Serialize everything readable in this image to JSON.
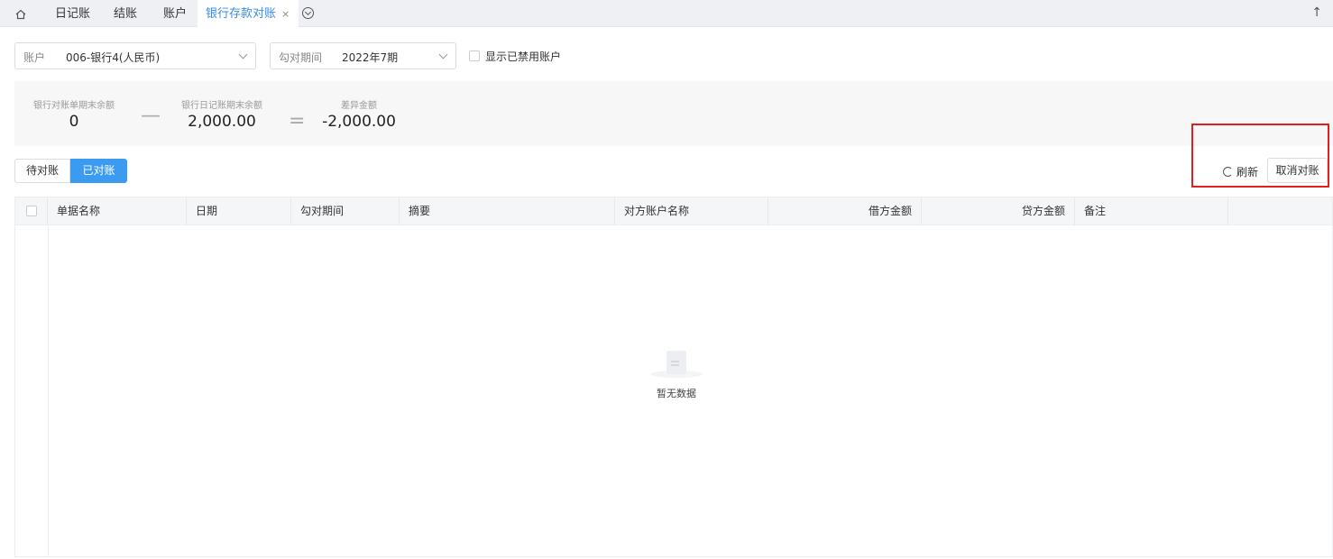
{
  "tabs": [
    {
      "label": "日记账"
    },
    {
      "label": "结账"
    },
    {
      "label": "账户"
    },
    {
      "label": "银行存款对账",
      "close": "×"
    }
  ],
  "filters": {
    "account_label": "账户",
    "account_value": "006-银行4(人民币)",
    "period_label": "勾对期间",
    "period_value": "2022年7期",
    "show_disabled_label": "显示已禁用账户"
  },
  "summary": {
    "bank_caption": "银行对账单期末余额",
    "bank_value": "0",
    "minus": "—",
    "journal_caption": "银行日记账期末余额",
    "journal_value": "2,000.00",
    "equals": "=",
    "diff_caption": "差异金额",
    "diff_value": "-2,000.00"
  },
  "toggle": {
    "pending": "待对账",
    "done": "已对账"
  },
  "actions": {
    "refresh": "刷新",
    "cancel": "取消对账"
  },
  "table": {
    "columns": [
      "单据名称",
      "日期",
      "勾对期间",
      "摘要",
      "对方账户名称",
      "借方金额",
      "贷方金额",
      "备注"
    ],
    "empty_text": "暂无数据"
  },
  "colors": {
    "accent": "#3a9bf0",
    "highlight": "#e02020"
  }
}
